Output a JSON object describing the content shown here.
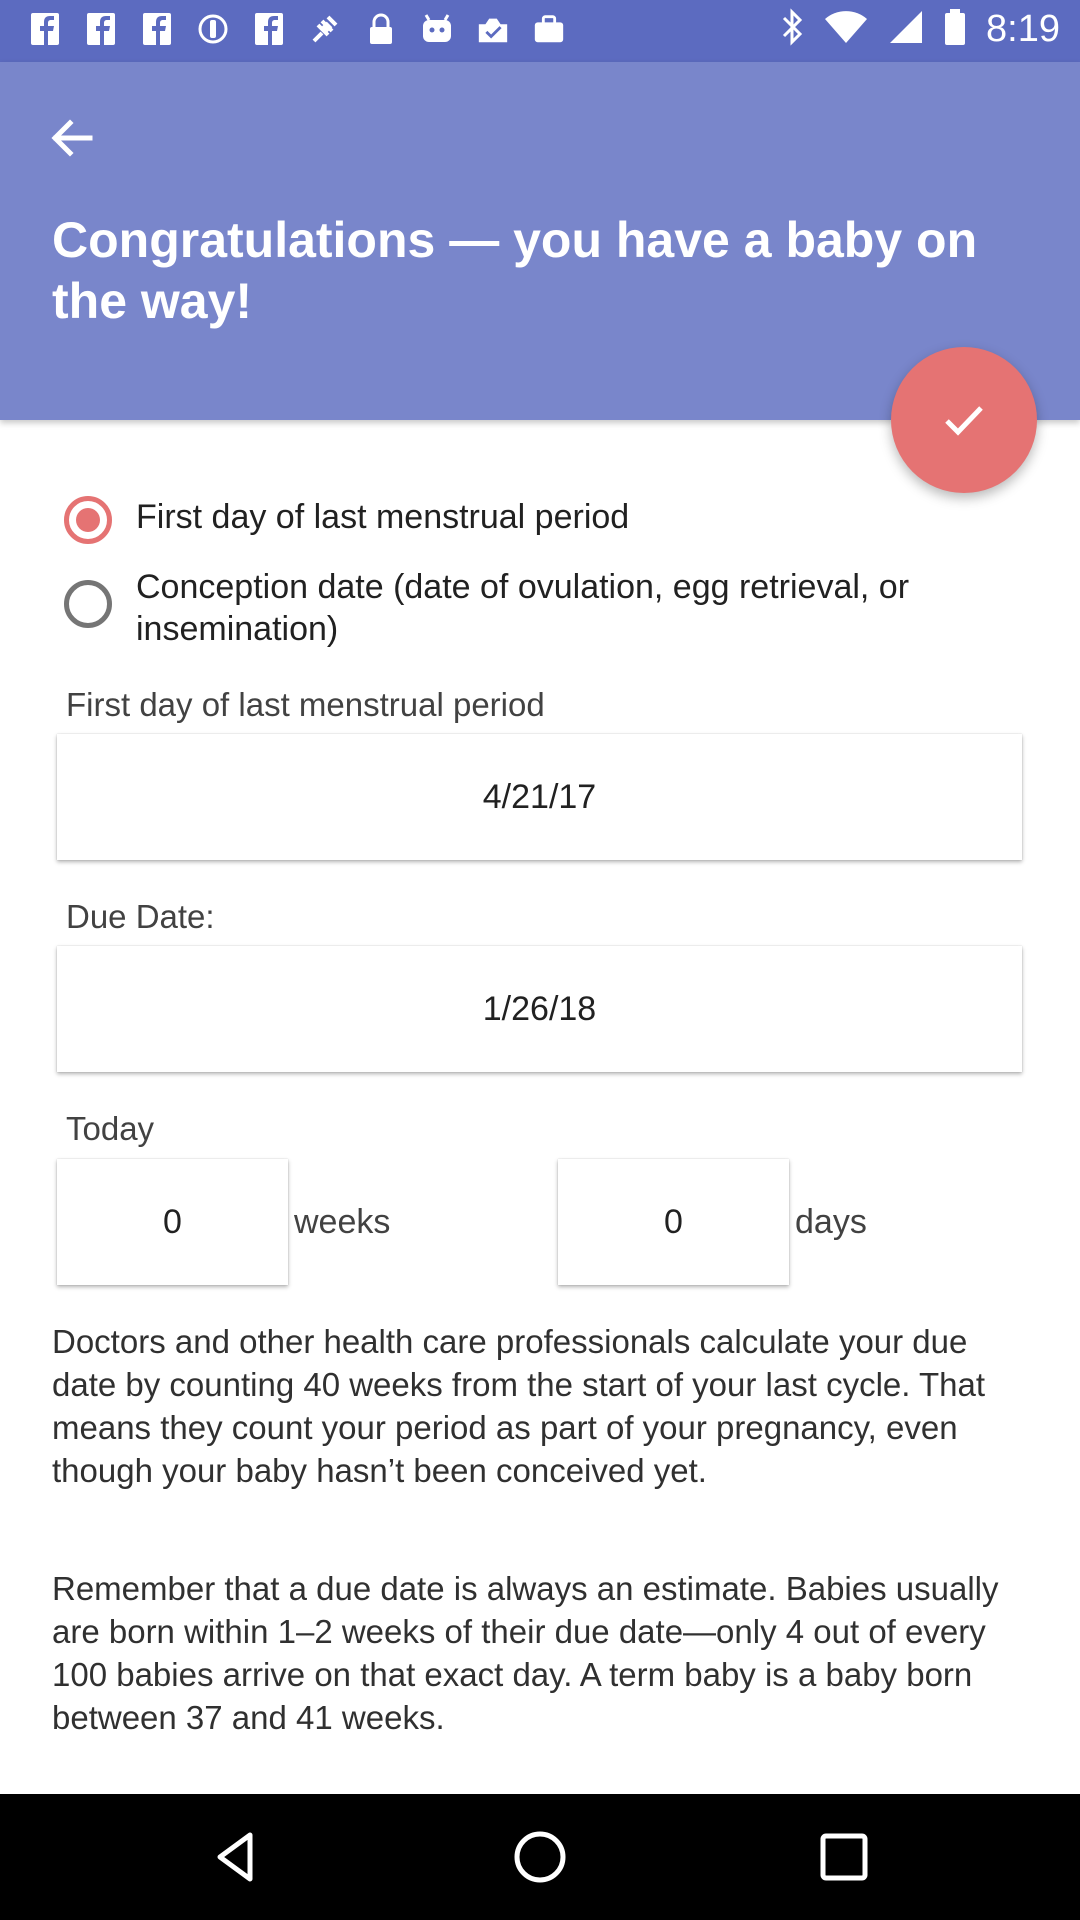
{
  "status_bar": {
    "time": "8:19",
    "left_icons": [
      "facebook-icon",
      "facebook-icon",
      "facebook-icon",
      "location-icon",
      "facebook-icon",
      "fake-gps-icon",
      "lock-icon",
      "android-icon",
      "photo-check-icon",
      "briefcase-icon"
    ],
    "right_icons": [
      "bluetooth-icon",
      "wifi-icon",
      "signal-icon",
      "battery-icon"
    ]
  },
  "header": {
    "title": "Congratulations — you have a baby on the way!"
  },
  "radio_options": [
    {
      "label": "First day of last menstrual period",
      "selected": true
    },
    {
      "label": "Conception date (date of ovulation, egg retrieval, or insemination)",
      "selected": false
    }
  ],
  "lmp": {
    "label": "First day of last menstrual period",
    "value": "4/21/17"
  },
  "due": {
    "label": "Due Date:",
    "value": "1/26/18"
  },
  "today": {
    "label": "Today",
    "weeks_value": "0",
    "weeks_unit": "weeks",
    "days_value": "0",
    "days_unit": "days"
  },
  "info": {
    "paragraph1": "Doctors and other health care professionals calculate your due date by counting 40 weeks from the start of your last cycle. That means they count your period as part of your pregnancy, even though your baby hasn’t been conceived yet.",
    "paragraph2": "Remember that a due date is always an estimate. Babies usually are born within 1–2 weeks of their due date—only 4 out of every 100 babies arrive on that exact day. A term baby is a baby born between 37 and 41 weeks."
  },
  "colors": {
    "status_bar": "#5c6bc0",
    "app_bar": "#7986cb",
    "accent": "#e57373"
  }
}
